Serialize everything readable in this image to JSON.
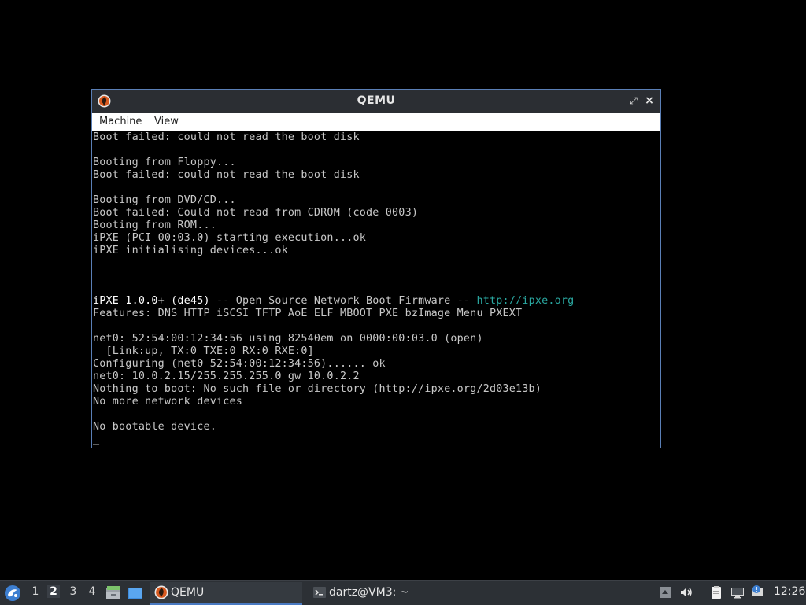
{
  "window": {
    "title": "QEMU",
    "minimize_label": "–",
    "maximize_label": "⤢",
    "close_label": "×",
    "menu": [
      "Machine",
      "View"
    ]
  },
  "console": {
    "lines": [
      {
        "text": "Boot failed: could not read the boot disk"
      },
      {
        "text": ""
      },
      {
        "text": "Booting from Floppy..."
      },
      {
        "text": "Boot failed: could not read the boot disk"
      },
      {
        "text": ""
      },
      {
        "text": "Booting from DVD/CD..."
      },
      {
        "text": "Boot failed: Could not read from CDROM (code 0003)"
      },
      {
        "text": "Booting from ROM..."
      },
      {
        "text": "iPXE (PCI 00:03.0) starting execution...ok"
      },
      {
        "text": "iPXE initialising devices...ok"
      },
      {
        "text": ""
      },
      {
        "text": ""
      },
      {
        "text": ""
      },
      {
        "ipxe_bright": "iPXE 1.0.0+ (de45)",
        "ipxe_mid": " -- Open Source Network Boot Firmware -- ",
        "ipxe_url": "http://ipxe.org"
      },
      {
        "text": "Features: DNS HTTP iSCSI TFTP AoE ELF MBOOT PXE bzImage Menu PXEXT"
      },
      {
        "text": ""
      },
      {
        "text": "net0: 52:54:00:12:34:56 using 82540em on 0000:00:03.0 (open)"
      },
      {
        "text": "  [Link:up, TX:0 TXE:0 RX:0 RXE:0]"
      },
      {
        "text": "Configuring (net0 52:54:00:12:34:56)...... ok"
      },
      {
        "text": "net0: 10.0.2.15/255.255.255.0 gw 10.0.2.2"
      },
      {
        "text": "Nothing to boot: No such file or directory (http://ipxe.org/2d03e13b)"
      },
      {
        "text": "No more network devices"
      },
      {
        "text": ""
      },
      {
        "text": "No bootable device."
      },
      {
        "text": "_"
      }
    ]
  },
  "taskbar": {
    "workspaces": [
      "1",
      "2",
      "3",
      "4"
    ],
    "active_workspace": "2",
    "tasks": [
      {
        "label": "QEMU",
        "icon": "qemu-icon",
        "active": true
      },
      {
        "label": "dartz@VM3: ~",
        "icon": "terminal-icon",
        "active": false
      }
    ],
    "clock": "12:26"
  },
  "colors": {
    "window_border": "#5a7fb6",
    "titlebar": "#2b2e33",
    "console_text": "#c8c8c8",
    "link_text": "#2aa7a0",
    "taskbar": "#2c3035"
  }
}
